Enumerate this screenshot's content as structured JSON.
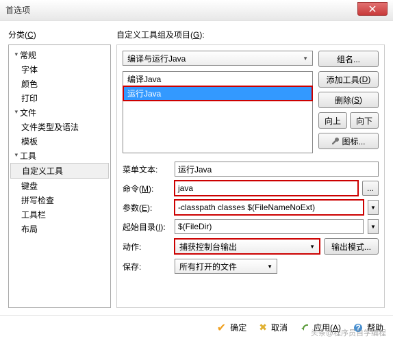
{
  "window": {
    "title": "首选项"
  },
  "left": {
    "label": "分类",
    "shortcut": "C",
    "tree": [
      {
        "label": "常规",
        "group": true
      },
      {
        "label": "字体"
      },
      {
        "label": "颜色"
      },
      {
        "label": "打印"
      },
      {
        "label": "文件",
        "group": true
      },
      {
        "label": "文件类型及语法"
      },
      {
        "label": "模板"
      },
      {
        "label": "工具",
        "group": true
      },
      {
        "label": "自定义工具",
        "selected": true
      },
      {
        "label": "键盘"
      },
      {
        "label": "拼写检查"
      },
      {
        "label": "工具栏"
      },
      {
        "label": "布局"
      }
    ]
  },
  "right": {
    "label": "自定义工具组及项目",
    "shortcut": "G",
    "group_combo": "编译与运行Java",
    "list": [
      {
        "label": "编译Java"
      },
      {
        "label": "运行Java",
        "selected": true
      }
    ],
    "buttons": {
      "group_name": "组名...",
      "add": "添加工具",
      "add_key": "D",
      "delete": "删除",
      "del_key": "S",
      "up": "向上",
      "down": "向下",
      "icon": "图标..."
    },
    "form": {
      "menu_text_label": "菜单文本:",
      "menu_text": "运行Java",
      "command_label": "命令",
      "command_key": "M",
      "command": "java",
      "args_label": "参数",
      "args_key": "E",
      "args": "-classpath classes $(FileNameNoExt)",
      "startdir_label": "起始目录",
      "startdir_key": "I",
      "startdir": "$(FileDir)",
      "action_label": "动作:",
      "action": "捕获控制台输出",
      "output_mode": "输出模式...",
      "save_label": "保存:",
      "save": "所有打开的文件"
    }
  },
  "footer": {
    "ok": "确定",
    "cancel": "取消",
    "apply": "应用",
    "apply_key": "A",
    "help": "帮助",
    "watermark": "头条@程序员自学编程"
  }
}
